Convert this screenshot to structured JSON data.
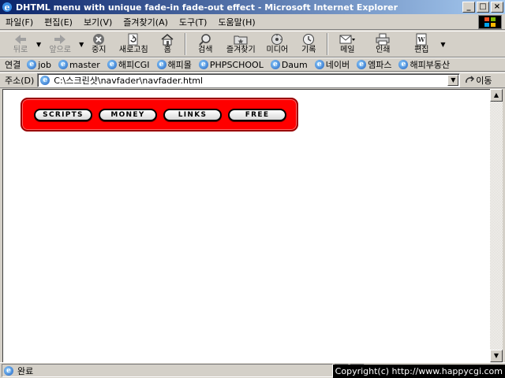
{
  "window": {
    "title": "DHTML menu with unique fade-in fade-out effect - Microsoft Internet Explorer",
    "minimize": "_",
    "maximize": "□",
    "close": "×"
  },
  "menubar": {
    "items": [
      "파일(F)",
      "편집(E)",
      "보기(V)",
      "즐겨찾기(A)",
      "도구(T)",
      "도움말(H)"
    ]
  },
  "toolbar": {
    "back": "뒤로",
    "forward": "앞으로",
    "stop": "중지",
    "refresh": "새로고침",
    "home": "홈",
    "search": "검색",
    "favorites": "즐겨찾기",
    "media": "미디어",
    "history": "기록",
    "mail": "메일",
    "print": "인쇄",
    "edit": "편집"
  },
  "links": {
    "label": "연결",
    "items": [
      "job",
      "master",
      "해피CGI",
      "해피몰",
      "PHPSCHOOL",
      "Daum",
      "네이버",
      "엠파스",
      "해피부동산"
    ]
  },
  "address": {
    "label": "주소(D)",
    "url": "C:\\스크린샷\\navfader\\navfader.html",
    "go": "이동"
  },
  "page": {
    "nav_buttons": [
      "SCRIPTS",
      "MONEY",
      "LINKS",
      "FREE"
    ]
  },
  "status": {
    "text": "완료",
    "copyright": "Copyright(c) http://www.happycgi.com"
  },
  "colors": {
    "titlebar_start": "#0a246a",
    "titlebar_end": "#a6caf0",
    "nav_panel": "#ff0000",
    "chrome": "#d4d0c8"
  }
}
